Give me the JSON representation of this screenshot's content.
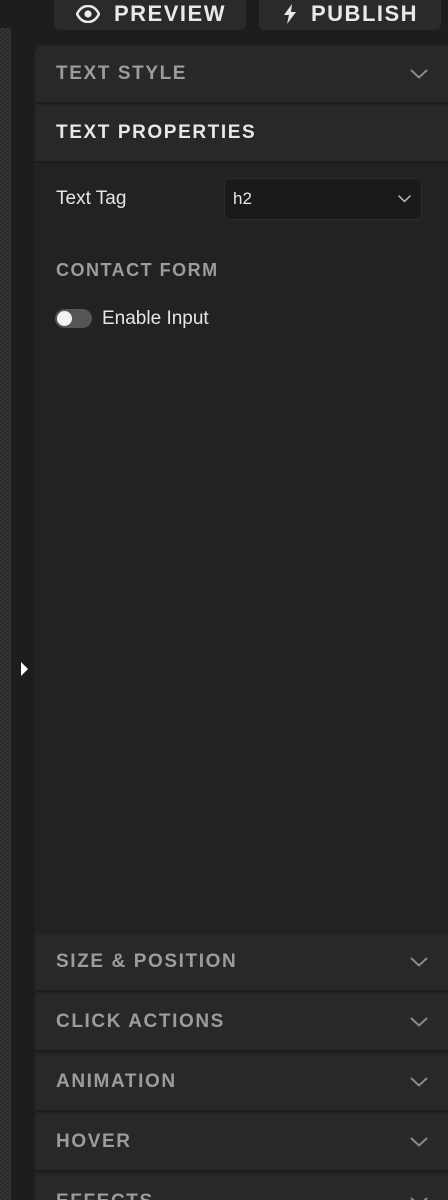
{
  "toolbar": {
    "preview_label": "PREVIEW",
    "publish_label": "PUBLISH"
  },
  "sections": {
    "text_style": {
      "title": "TEXT STYLE"
    },
    "text_properties": {
      "title": "TEXT PROPERTIES",
      "text_tag_label": "Text Tag",
      "text_tag_value": "h2",
      "contact_form_heading": "CONTACT FORM",
      "enable_input_label": "Enable Input",
      "enable_input_on": false
    },
    "size_position": {
      "title": "SIZE & POSITION"
    },
    "click_actions": {
      "title": "CLICK ACTIONS"
    },
    "animation": {
      "title": "ANIMATION"
    },
    "hover": {
      "title": "HOVER"
    },
    "effects": {
      "title": "EFFECTS"
    }
  },
  "colors": {
    "panel_bg": "#222222",
    "header_bg": "#282828",
    "text_primary": "#e6e6e6",
    "text_muted": "#9c9c9c",
    "toggle_off": "#555555"
  },
  "icons": {
    "preview": "eye-icon",
    "publish": "lightning-icon",
    "collapse": "caret-right-icon",
    "expand": "chevron-down-icon"
  }
}
